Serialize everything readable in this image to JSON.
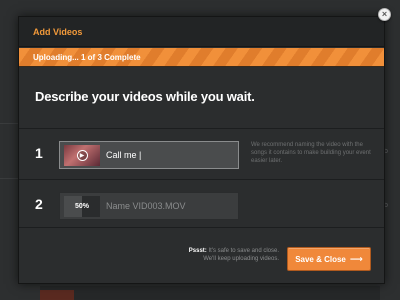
{
  "modal": {
    "title": "Add Videos",
    "progress": {
      "label": "Uploading... 1 of 3 Complete",
      "completed": 1,
      "total": 3
    },
    "headline": "Describe your videos while you wait.",
    "rows": [
      {
        "number": "1",
        "thumbnail_icon": "play-icon",
        "value": "Call me |",
        "placeholder": ""
      },
      {
        "number": "2",
        "upload_progress": "50%",
        "upload_fraction": 0.5,
        "value": "",
        "placeholder": "Name VID003.MOV"
      }
    ],
    "hint": "We recommend naming the video with the songs it contains to make building your event easier later.",
    "footer_note": {
      "emphasis": "Pssst:",
      "line1": " It's safe to save and close.",
      "line2": "We'll keep uploading videos."
    },
    "save_button": {
      "label": "Save & Close",
      "icon": "arrow-right-icon"
    },
    "close_icon": "close-icon"
  },
  "colors": {
    "accent": "#f0883a",
    "title": "#f39a3a",
    "background": "#2b2d2e"
  }
}
